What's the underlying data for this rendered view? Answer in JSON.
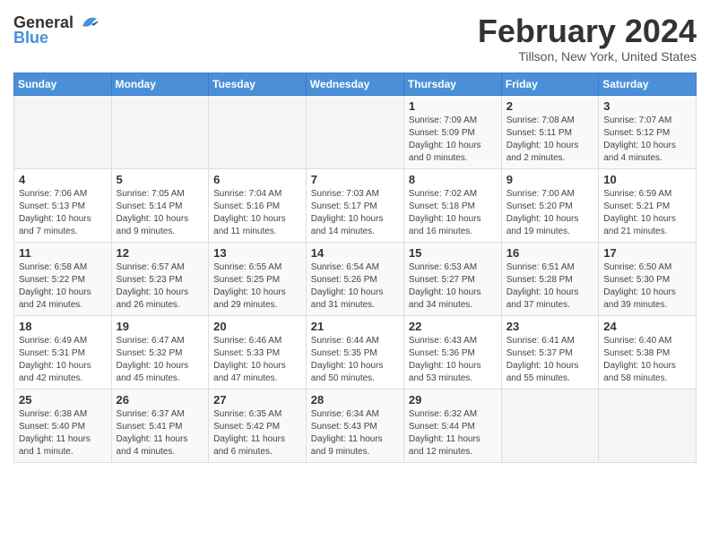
{
  "header": {
    "logo_general": "General",
    "logo_blue": "Blue",
    "month_title": "February 2024",
    "location": "Tillson, New York, United States"
  },
  "days_of_week": [
    "Sunday",
    "Monday",
    "Tuesday",
    "Wednesday",
    "Thursday",
    "Friday",
    "Saturday"
  ],
  "weeks": [
    [
      {
        "day": "",
        "info": ""
      },
      {
        "day": "",
        "info": ""
      },
      {
        "day": "",
        "info": ""
      },
      {
        "day": "",
        "info": ""
      },
      {
        "day": "1",
        "info": "Sunrise: 7:09 AM\nSunset: 5:09 PM\nDaylight: 10 hours\nand 0 minutes."
      },
      {
        "day": "2",
        "info": "Sunrise: 7:08 AM\nSunset: 5:11 PM\nDaylight: 10 hours\nand 2 minutes."
      },
      {
        "day": "3",
        "info": "Sunrise: 7:07 AM\nSunset: 5:12 PM\nDaylight: 10 hours\nand 4 minutes."
      }
    ],
    [
      {
        "day": "4",
        "info": "Sunrise: 7:06 AM\nSunset: 5:13 PM\nDaylight: 10 hours\nand 7 minutes."
      },
      {
        "day": "5",
        "info": "Sunrise: 7:05 AM\nSunset: 5:14 PM\nDaylight: 10 hours\nand 9 minutes."
      },
      {
        "day": "6",
        "info": "Sunrise: 7:04 AM\nSunset: 5:16 PM\nDaylight: 10 hours\nand 11 minutes."
      },
      {
        "day": "7",
        "info": "Sunrise: 7:03 AM\nSunset: 5:17 PM\nDaylight: 10 hours\nand 14 minutes."
      },
      {
        "day": "8",
        "info": "Sunrise: 7:02 AM\nSunset: 5:18 PM\nDaylight: 10 hours\nand 16 minutes."
      },
      {
        "day": "9",
        "info": "Sunrise: 7:00 AM\nSunset: 5:20 PM\nDaylight: 10 hours\nand 19 minutes."
      },
      {
        "day": "10",
        "info": "Sunrise: 6:59 AM\nSunset: 5:21 PM\nDaylight: 10 hours\nand 21 minutes."
      }
    ],
    [
      {
        "day": "11",
        "info": "Sunrise: 6:58 AM\nSunset: 5:22 PM\nDaylight: 10 hours\nand 24 minutes."
      },
      {
        "day": "12",
        "info": "Sunrise: 6:57 AM\nSunset: 5:23 PM\nDaylight: 10 hours\nand 26 minutes."
      },
      {
        "day": "13",
        "info": "Sunrise: 6:55 AM\nSunset: 5:25 PM\nDaylight: 10 hours\nand 29 minutes."
      },
      {
        "day": "14",
        "info": "Sunrise: 6:54 AM\nSunset: 5:26 PM\nDaylight: 10 hours\nand 31 minutes."
      },
      {
        "day": "15",
        "info": "Sunrise: 6:53 AM\nSunset: 5:27 PM\nDaylight: 10 hours\nand 34 minutes."
      },
      {
        "day": "16",
        "info": "Sunrise: 6:51 AM\nSunset: 5:28 PM\nDaylight: 10 hours\nand 37 minutes."
      },
      {
        "day": "17",
        "info": "Sunrise: 6:50 AM\nSunset: 5:30 PM\nDaylight: 10 hours\nand 39 minutes."
      }
    ],
    [
      {
        "day": "18",
        "info": "Sunrise: 6:49 AM\nSunset: 5:31 PM\nDaylight: 10 hours\nand 42 minutes."
      },
      {
        "day": "19",
        "info": "Sunrise: 6:47 AM\nSunset: 5:32 PM\nDaylight: 10 hours\nand 45 minutes."
      },
      {
        "day": "20",
        "info": "Sunrise: 6:46 AM\nSunset: 5:33 PM\nDaylight: 10 hours\nand 47 minutes."
      },
      {
        "day": "21",
        "info": "Sunrise: 6:44 AM\nSunset: 5:35 PM\nDaylight: 10 hours\nand 50 minutes."
      },
      {
        "day": "22",
        "info": "Sunrise: 6:43 AM\nSunset: 5:36 PM\nDaylight: 10 hours\nand 53 minutes."
      },
      {
        "day": "23",
        "info": "Sunrise: 6:41 AM\nSunset: 5:37 PM\nDaylight: 10 hours\nand 55 minutes."
      },
      {
        "day": "24",
        "info": "Sunrise: 6:40 AM\nSunset: 5:38 PM\nDaylight: 10 hours\nand 58 minutes."
      }
    ],
    [
      {
        "day": "25",
        "info": "Sunrise: 6:38 AM\nSunset: 5:40 PM\nDaylight: 11 hours\nand 1 minute."
      },
      {
        "day": "26",
        "info": "Sunrise: 6:37 AM\nSunset: 5:41 PM\nDaylight: 11 hours\nand 4 minutes."
      },
      {
        "day": "27",
        "info": "Sunrise: 6:35 AM\nSunset: 5:42 PM\nDaylight: 11 hours\nand 6 minutes."
      },
      {
        "day": "28",
        "info": "Sunrise: 6:34 AM\nSunset: 5:43 PM\nDaylight: 11 hours\nand 9 minutes."
      },
      {
        "day": "29",
        "info": "Sunrise: 6:32 AM\nSunset: 5:44 PM\nDaylight: 11 hours\nand 12 minutes."
      },
      {
        "day": "",
        "info": ""
      },
      {
        "day": "",
        "info": ""
      }
    ]
  ]
}
